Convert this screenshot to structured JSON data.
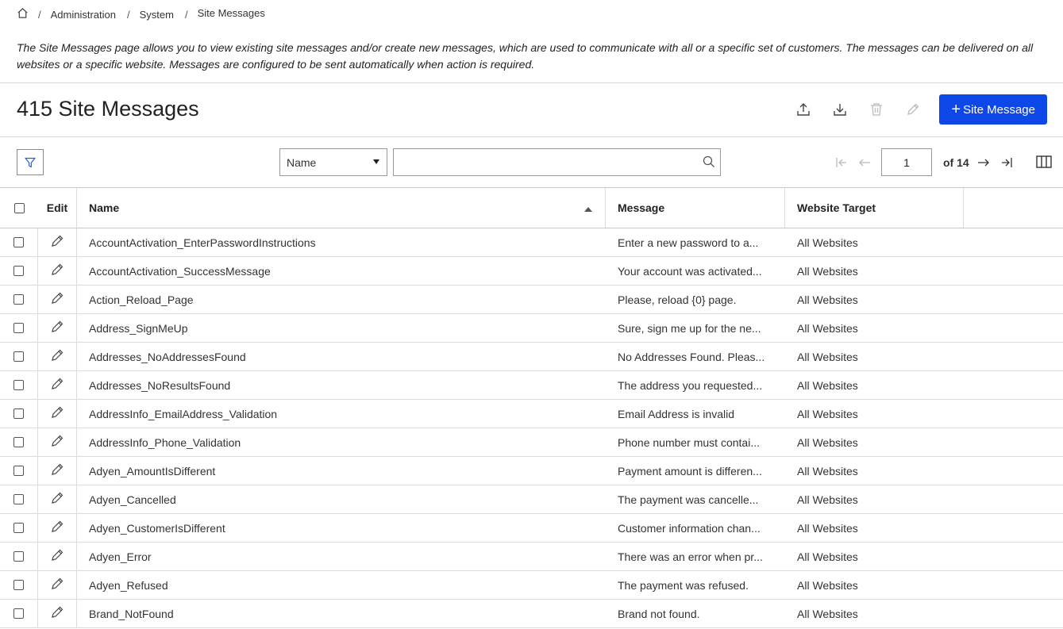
{
  "breadcrumb": {
    "home_icon": "home-icon",
    "items": [
      "Administration",
      "System",
      "Site Messages"
    ]
  },
  "description": "The Site Messages page allows you to view existing site messages and/or create new messages, which are used to communicate with all or a specific set of customers. The messages can be delivered on all websites or a specific website. Messages are configured to be sent automatically when action is required.",
  "header": {
    "title": "415 Site Messages",
    "add_button_label": "Site Message",
    "add_button_icon": "plus-icon",
    "accent_color": "#0d47e8"
  },
  "filter_bar": {
    "field_select_value": "Name",
    "search_value": "",
    "page_value": "1",
    "of_label": "of",
    "total_pages": "14"
  },
  "columns": {
    "edit": "Edit",
    "name": "Name",
    "message": "Message",
    "website": "Website Target"
  },
  "rows": [
    {
      "name": "AccountActivation_EnterPasswordInstructions",
      "message": "Enter a new password to a...",
      "website": "All Websites"
    },
    {
      "name": "AccountActivation_SuccessMessage",
      "message": "Your account was activated...",
      "website": "All Websites"
    },
    {
      "name": "Action_Reload_Page",
      "message": "Please, reload {0} page.",
      "website": "All Websites"
    },
    {
      "name": "Address_SignMeUp",
      "message": "Sure, sign me up for the ne...",
      "website": "All Websites"
    },
    {
      "name": "Addresses_NoAddressesFound",
      "message": "No Addresses Found. Pleas...",
      "website": "All Websites"
    },
    {
      "name": "Addresses_NoResultsFound",
      "message": "The address you requested...",
      "website": "All Websites"
    },
    {
      "name": "AddressInfo_EmailAddress_Validation",
      "message": "Email Address is invalid",
      "website": "All Websites"
    },
    {
      "name": "AddressInfo_Phone_Validation",
      "message": "Phone number must contai...",
      "website": "All Websites"
    },
    {
      "name": "Adyen_AmountIsDifferent",
      "message": "Payment amount is differen...",
      "website": "All Websites"
    },
    {
      "name": "Adyen_Cancelled",
      "message": "The payment was cancelle...",
      "website": "All Websites"
    },
    {
      "name": "Adyen_CustomerIsDifferent",
      "message": "Customer information chan...",
      "website": "All Websites"
    },
    {
      "name": "Adyen_Error",
      "message": "There was an error when pr...",
      "website": "All Websites"
    },
    {
      "name": "Adyen_Refused",
      "message": "The payment was refused.",
      "website": "All Websites"
    },
    {
      "name": "Brand_NotFound",
      "message": "Brand not found.",
      "website": "All Websites"
    }
  ]
}
